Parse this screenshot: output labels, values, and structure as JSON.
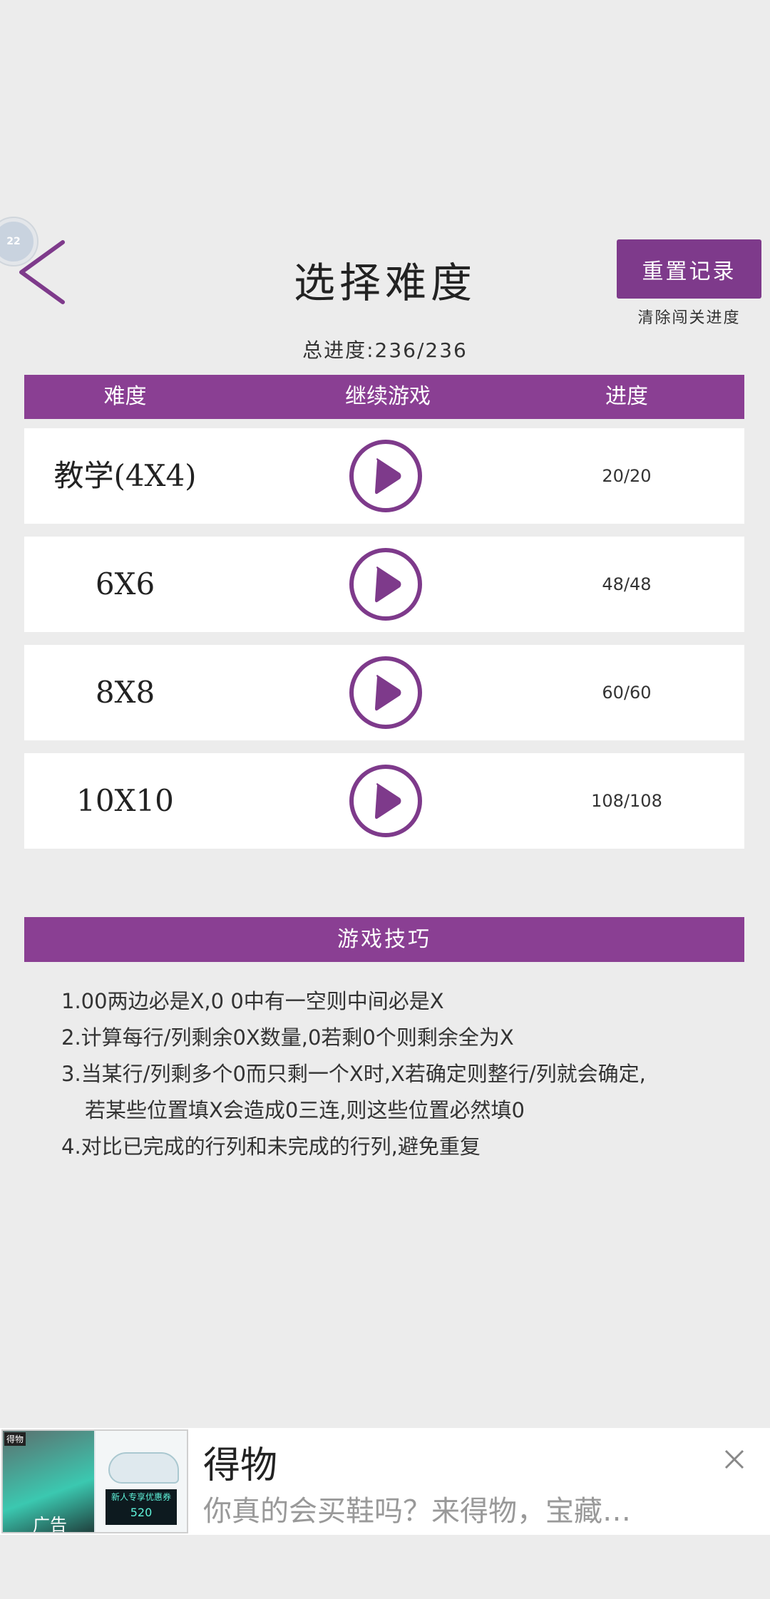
{
  "floating_bubble": {
    "label": "22"
  },
  "header": {
    "title": "选择难度",
    "reset_button": "重置记录",
    "reset_subtitle": "清除闯关进度",
    "total_progress": "总进度:236/236"
  },
  "table": {
    "columns": [
      "难度",
      "继续游戏",
      "进度"
    ],
    "rows": [
      {
        "name": "教学(4X4)",
        "progress": "20/20"
      },
      {
        "name": "6X6",
        "progress": "48/48"
      },
      {
        "name": "8X8",
        "progress": "60/60"
      },
      {
        "name": "10X10",
        "progress": "108/108"
      }
    ]
  },
  "tips": {
    "title": "游戏技巧",
    "lines": [
      "1.00两边必是X,0 0中有一空则中间必是X",
      "2.计算每行/列剩余0X数量,0若剩0个则剩余全为X",
      "3.当某行/列剩多个0而只剩一个X时,X若确定则整行/列就会确定,",
      "若某些位置填X会造成0三连,则这些位置必然填0",
      "4.对比已完成的行列和未完成的行列,避免重复"
    ]
  },
  "ad": {
    "label": "广告",
    "brand_tag": "得物",
    "image_price": "520",
    "image_caption": "新人专享优惠券",
    "title": "得物",
    "description": "你真的会买鞋吗？来得物，宝藏…"
  },
  "colors": {
    "accent": "#8a3f93",
    "button": "#7e3a8b",
    "background": "#ececec"
  },
  "icons": {
    "back": "chevron-left-icon",
    "play": "play-circle-icon",
    "close": "close-icon"
  }
}
